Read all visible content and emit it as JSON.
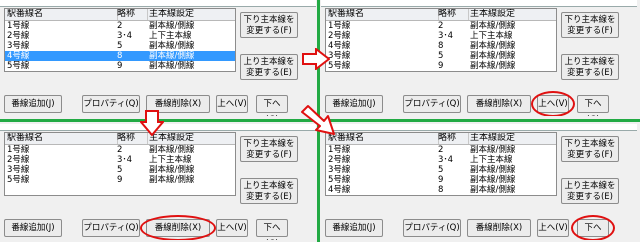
{
  "colors": {
    "divider": "#22aa44",
    "highlight": "#e01010",
    "selection": "#3399ff"
  },
  "columns": {
    "name": "駅番線名",
    "abbr": "略称",
    "setting": "主本線設定"
  },
  "buttons": {
    "down_main_l1": "下り主本線を",
    "down_main_l2": "変更する(F)",
    "up_main_l1": "上り主本線を",
    "up_main_l2": "変更する(E)",
    "add": "番線追加(J)",
    "props": "プロパティ(Q)",
    "delete": "番線削除(X)",
    "up": "上へ(V)",
    "down": "下へ(G)"
  },
  "panels": [
    {
      "rows": [
        {
          "name": "1号線",
          "abbr": "2",
          "setting": "副本線/側線"
        },
        {
          "name": "2号線",
          "abbr": "3･4",
          "setting": "上下主本線"
        },
        {
          "name": "3号線",
          "abbr": "5",
          "setting": "副本線/側線"
        },
        {
          "name": "4号線",
          "abbr": "8",
          "setting": "副本線/側線",
          "selected": true
        },
        {
          "name": "5号線",
          "abbr": "9",
          "setting": "副本線/側線"
        }
      ]
    },
    {
      "rows": [
        {
          "name": "1号線",
          "abbr": "2",
          "setting": "副本線/側線"
        },
        {
          "name": "2号線",
          "abbr": "3･4",
          "setting": "上下主本線"
        },
        {
          "name": "4号線",
          "abbr": "8",
          "setting": "副本線/側線"
        },
        {
          "name": "3号線",
          "abbr": "5",
          "setting": "副本線/側線"
        },
        {
          "name": "5号線",
          "abbr": "9",
          "setting": "副本線/側線"
        }
      ]
    },
    {
      "rows": [
        {
          "name": "1号線",
          "abbr": "2",
          "setting": "副本線/側線"
        },
        {
          "name": "2号線",
          "abbr": "3･4",
          "setting": "上下主本線"
        },
        {
          "name": "3号線",
          "abbr": "5",
          "setting": "副本線/側線"
        },
        {
          "name": "5号線",
          "abbr": "9",
          "setting": "副本線/側線"
        }
      ]
    },
    {
      "rows": [
        {
          "name": "1号線",
          "abbr": "2",
          "setting": "副本線/側線"
        },
        {
          "name": "2号線",
          "abbr": "3･4",
          "setting": "上下主本線"
        },
        {
          "name": "3号線",
          "abbr": "5",
          "setting": "副本線/側線"
        },
        {
          "name": "5号線",
          "abbr": "9",
          "setting": "副本線/側線"
        },
        {
          "name": "4号線",
          "abbr": "8",
          "setting": "副本線/側線"
        }
      ]
    }
  ]
}
